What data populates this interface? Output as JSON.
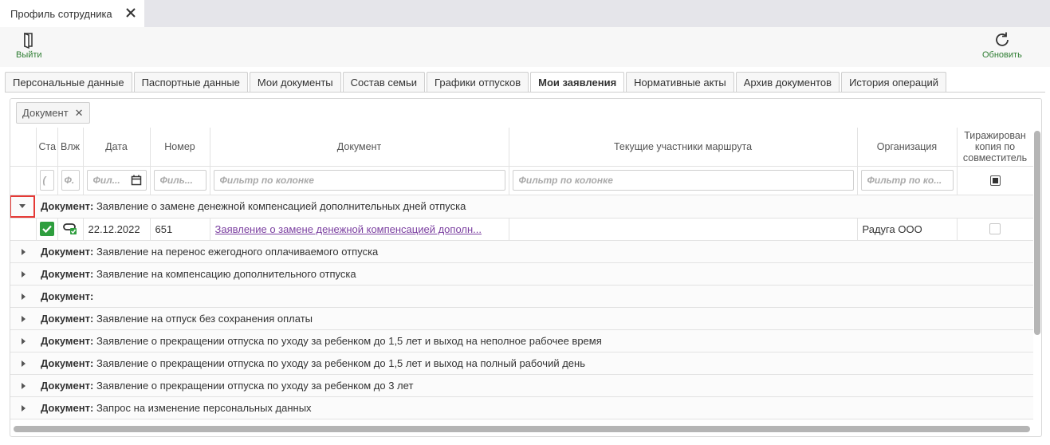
{
  "window": {
    "tab_title": "Профиль сотрудника"
  },
  "toolbar": {
    "exit_label": "Выйти",
    "refresh_label": "Обновить"
  },
  "section_tabs": [
    {
      "label": "Персональные данные"
    },
    {
      "label": "Паспортные данные"
    },
    {
      "label": "Мои документы"
    },
    {
      "label": "Состав семьи"
    },
    {
      "label": "Графики отпусков"
    },
    {
      "label": "Мои заявления"
    },
    {
      "label": "Нормативные акты"
    },
    {
      "label": "Архив документов"
    },
    {
      "label": "История операций"
    }
  ],
  "active_tab": "Мои заявления",
  "group_chip": {
    "label": "Документ"
  },
  "columns": {
    "status": "Ста",
    "attach": "Влж",
    "date": "Дата",
    "number": "Номер",
    "document": "Документ",
    "participants": "Текущие участники маршрута",
    "org": "Организация",
    "copy": "Тиражирован копия по совместитель"
  },
  "filters": {
    "status": "(",
    "attach": "Ф.",
    "date": "Фил...",
    "number": "Филь...",
    "document": "Фильтр по колонке",
    "participants": "Фильтр по колонке",
    "org": "Фильтр по ко..."
  },
  "group_prefix": "Документ:",
  "groups": [
    {
      "title": "Заявление о замене денежной компенсацией дополнительных дней отпуска",
      "expanded": true
    },
    {
      "title": "Заявление на перенос ежегодного оплачиваемого отпуска",
      "expanded": false
    },
    {
      "title": "Заявление на компенсацию дополнительного отпуска",
      "expanded": false
    },
    {
      "title": "",
      "expanded": false
    },
    {
      "title": "Заявление на отпуск без сохранения оплаты",
      "expanded": false
    },
    {
      "title": "Заявление о прекращении отпуска по уходу за ребенком до 1,5 лет и выход на неполное рабочее время",
      "expanded": false
    },
    {
      "title": "Заявление о прекращении отпуска по уходу за ребенком до 1,5 лет и выход на полный рабочий день",
      "expanded": false
    },
    {
      "title": "Заявление о прекращении отпуска по уходу за ребенком до 3 лет",
      "expanded": false
    },
    {
      "title": "Запрос на изменение персональных данных",
      "expanded": false
    }
  ],
  "expanded_row": {
    "date": "22.12.2022",
    "number": "651",
    "document": "Заявление о замене денежной компенсацией дополн...",
    "participants": "",
    "org": "Радуга ООО"
  },
  "colors": {
    "accent_green": "#2e7d32",
    "link_purple": "#7b3fa0",
    "highlight_red": "#e53935"
  }
}
